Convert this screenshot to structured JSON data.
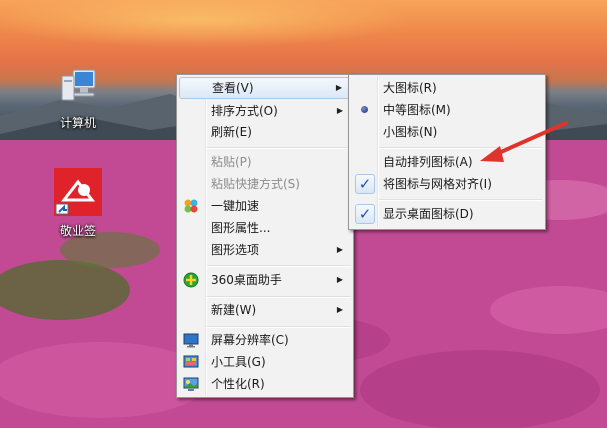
{
  "desktop": {
    "icons": [
      {
        "label": "计算机",
        "icon": "computer-icon"
      },
      {
        "label": "敬业签",
        "icon": "app-shortcut-icon"
      }
    ]
  },
  "context_menu": {
    "items": [
      {
        "label": "查看(V)",
        "submenu": true,
        "highlighted": true
      },
      {
        "label": "排序方式(O)",
        "submenu": true
      },
      {
        "label": "刷新(E)"
      },
      {
        "label": "粘贴(P)",
        "disabled": true
      },
      {
        "label": "粘贴快捷方式(S)",
        "disabled": true
      },
      {
        "label": "一键加速",
        "icon": "boost-icon"
      },
      {
        "label": "图形属性...",
        "icon": ""
      },
      {
        "label": "图形选项",
        "submenu": true
      },
      {
        "label": "360桌面助手",
        "submenu": true,
        "icon": "360-icon"
      },
      {
        "label": "新建(W)",
        "submenu": true
      },
      {
        "label": "屏幕分辨率(C)",
        "icon": "monitor-icon"
      },
      {
        "label": "小工具(G)",
        "icon": "gadgets-icon"
      },
      {
        "label": "个性化(R)",
        "icon": "personalize-icon"
      }
    ]
  },
  "view_submenu": {
    "items": [
      {
        "label": "大图标(R)"
      },
      {
        "label": "中等图标(M)",
        "selected": true
      },
      {
        "label": "小图标(N)"
      },
      {
        "label": "自动排列图标(A)"
      },
      {
        "label": "将图标与网格对齐(I)",
        "checked": true
      },
      {
        "label": "显示桌面图标(D)",
        "checked": true
      }
    ]
  },
  "annotation": {
    "color": "#e0332b"
  }
}
